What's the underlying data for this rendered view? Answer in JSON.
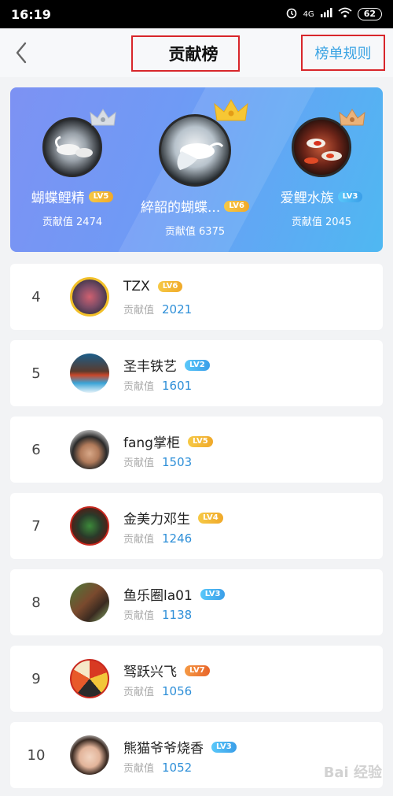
{
  "status_bar": {
    "time": "16:19",
    "signal_text": "4G",
    "battery": "62"
  },
  "nav": {
    "title": "贡献榜",
    "rules_link": "榜单规则"
  },
  "top3": [
    {
      "rank": 2,
      "name": "蝴蝶鲤精",
      "level": "LV5",
      "level_color": "gold",
      "value_label": "贡献值",
      "value": "2474",
      "crown": "silver"
    },
    {
      "rank": 1,
      "name": "綷韶的蝴蝶...",
      "level": "LV6",
      "level_color": "gold",
      "value_label": "贡献值",
      "value": "6375",
      "crown": "gold"
    },
    {
      "rank": 3,
      "name": "爱鲤水族",
      "level": "LV3",
      "level_color": "blue",
      "value_label": "贡献值",
      "value": "2045",
      "crown": "bronze"
    }
  ],
  "ranking": [
    {
      "rank": "4",
      "name": "TZX",
      "level": "LV6",
      "level_color": "gold",
      "value_label": "贡献值",
      "value": "2021"
    },
    {
      "rank": "5",
      "name": "圣丰铁艺",
      "level": "LV2",
      "level_color": "blue",
      "value_label": "贡献值",
      "value": "1601"
    },
    {
      "rank": "6",
      "name": "fang掌柜",
      "level": "LV5",
      "level_color": "gold",
      "value_label": "贡献值",
      "value": "1503"
    },
    {
      "rank": "7",
      "name": "金美力邓生",
      "level": "LV4",
      "level_color": "gold",
      "value_label": "贡献值",
      "value": "1246"
    },
    {
      "rank": "8",
      "name": "鱼乐圈la01",
      "level": "LV3",
      "level_color": "blue",
      "value_label": "贡献值",
      "value": "1138"
    },
    {
      "rank": "9",
      "name": "驽跃兴飞",
      "level": "LV7",
      "level_color": "orange",
      "value_label": "贡献值",
      "value": "1056"
    },
    {
      "rank": "10",
      "name": "熊猫爷爷烧香",
      "level": "LV3",
      "level_color": "blue",
      "value_label": "贡献值",
      "value": "1052"
    }
  ],
  "watermark": "Bai 经验",
  "colors": {
    "accent_blue": "#3aa3e3",
    "highlight_red": "#d8262b",
    "value_blue": "#2e8fd8"
  }
}
